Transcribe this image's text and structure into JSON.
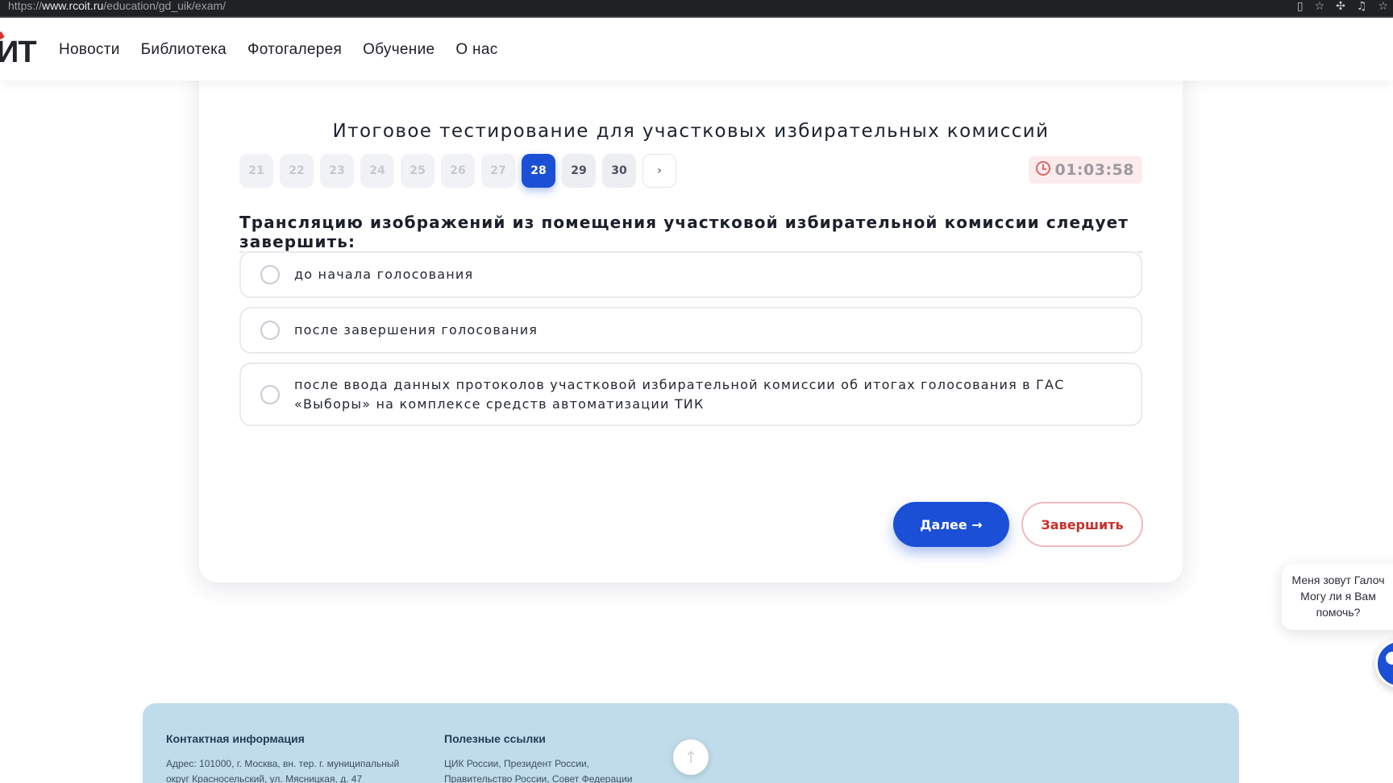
{
  "browser": {
    "url_prefix": "https://",
    "url_host": "www.rcoit.ru",
    "url_path": "/education/gd_uik/exam/",
    "icons": [
      "reader-icon",
      "star-icon",
      "extensions-icon",
      "profile-icon",
      "favorites-icon"
    ]
  },
  "header": {
    "logo_text": "ИТ",
    "nav": [
      "Новости",
      "Библиотека",
      "Фотогалерея",
      "Обучение",
      "О нас"
    ]
  },
  "exam": {
    "title": "Итоговое тестирование для участковых избирательных комиссий",
    "pages": [
      "21",
      "22",
      "23",
      "24",
      "25",
      "26",
      "27",
      "28",
      "29",
      "30"
    ],
    "current_page": "28",
    "next_page_label": "›",
    "timer": "01:03:58",
    "question": "Трансляцию изображений из помещения участковой избирательной комиссии следует завершить:",
    "options": [
      {
        "line1": "до начала голосования",
        "line2": ""
      },
      {
        "line1": "после завершения голосования",
        "line2": ""
      },
      {
        "line1": "после ввода данных протоколов участковой избирательной комиссии об итогах голосования в ГАС",
        "line2": "«Выборы» на комплексе средств автоматизации ТИК"
      }
    ],
    "next_button": "Далее →",
    "finish_button": "Завершить"
  },
  "chat": {
    "line1": "Меня зовут Галоч",
    "line2": "Могу ли я Вам",
    "line3": "помочь?"
  },
  "footer": {
    "contacts_title": "Контактная информация",
    "contacts_line1": "Адрес:  101000, г. Москва, вн. тер. г. муниципальный",
    "contacts_line2": "округ Красносельский, ул. Мясницкая, д. 47",
    "links_title": "Полезные ссылки",
    "links_line1": "ЦИК России, Президент России,",
    "links_line2": "Правительство России, Совет Федерации",
    "to_top_label": "↑"
  },
  "colors": {
    "accent": "#1b4fd6",
    "danger": "#c9302c",
    "footer_bg": "#c0dbe9"
  }
}
